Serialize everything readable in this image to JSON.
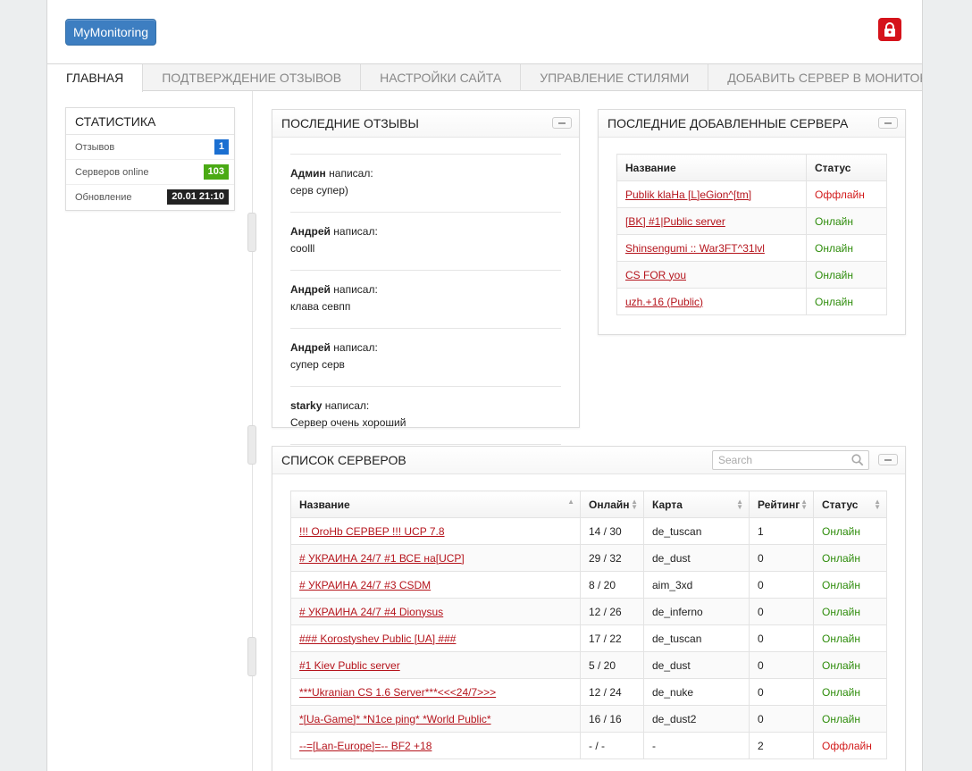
{
  "app": {
    "brand": "MyMonitoring"
  },
  "nav": {
    "items": [
      {
        "label": "ГЛАВНАЯ",
        "name": "nav-home"
      },
      {
        "label": "ПОДТВЕРЖДЕНИЕ ОТЗЫВОВ",
        "name": "nav-review-confirm"
      },
      {
        "label": "НАСТРОЙКИ САЙТА",
        "name": "nav-site-settings"
      },
      {
        "label": "УПРАВЛЕНИЕ СТИЛЯМИ",
        "name": "nav-style-manage"
      },
      {
        "label": "ДОБАВИТЬ СЕРВЕР В МОНИТОРИНГ",
        "name": "nav-add-server"
      }
    ],
    "active": 0
  },
  "stats": {
    "title": "СТАТИСТИКА",
    "rows": [
      {
        "label": "Отзывов",
        "value": "1",
        "color": "blue"
      },
      {
        "label": "Серверов online",
        "value": "103",
        "color": "green"
      },
      {
        "label": "Обновление",
        "value": "20.01 21:10",
        "color": "dark"
      }
    ]
  },
  "reviews": {
    "title": "ПОСЛЕДНИЕ ОТЗЫВЫ",
    "wrote": "написал:",
    "items": [
      {
        "author": "Админ",
        "text": "серв супер)"
      },
      {
        "author": "Андрей",
        "text": "coolll"
      },
      {
        "author": "Андрей",
        "text": "клава севпп"
      },
      {
        "author": "Андрей",
        "text": "супер серв"
      },
      {
        "author": "starky",
        "text": "Сервер очень хороший"
      }
    ]
  },
  "recent": {
    "title": "ПОСЛЕДНИЕ ДОБАВЛЕННЫЕ СЕРВЕРА",
    "headers": [
      "Название",
      "Статус"
    ],
    "rows": [
      {
        "name": "Publik klaHa [L]eGion^[tm]",
        "status": "Оффлайн",
        "online": false
      },
      {
        "name": "[BK] #1|Public server",
        "status": "Онлайн",
        "online": true
      },
      {
        "name": "Shinsengumi :: War3FT^31lvl",
        "status": "Онлайн",
        "online": true
      },
      {
        "name": "CS FOR you",
        "status": "Онлайн",
        "online": true
      },
      {
        "name": "uzh.+16 (Public)",
        "status": "Онлайн",
        "online": true
      }
    ]
  },
  "servers": {
    "title": "СПИСОК СЕРВЕРОВ",
    "search_placeholder": "Search",
    "headers": [
      "Название",
      "Онлайн",
      "Карта",
      "Рейтинг",
      "Статус"
    ],
    "rows": [
      {
        "name": "!!! OroHb СЕРВЕР !!! UCP 7.8",
        "online": "14 / 30",
        "map": "de_tuscan",
        "rating": "1",
        "status": "Онлайн",
        "up": true
      },
      {
        "name": "# УКРАИНА 24/7 #1 ВСЕ на[UCP]",
        "online": "29 / 32",
        "map": "de_dust",
        "rating": "0",
        "status": "Онлайн",
        "up": true
      },
      {
        "name": "# УКРАИНА 24/7 #3 CSDM",
        "online": "8 / 20",
        "map": "aim_3xd",
        "rating": "0",
        "status": "Онлайн",
        "up": true
      },
      {
        "name": "# УКРАИНА 24/7 #4 Dionysus",
        "online": "12 / 26",
        "map": "de_inferno",
        "rating": "0",
        "status": "Онлайн",
        "up": true
      },
      {
        "name": "### Korostyshev Public [UA] ###",
        "online": "17 / 22",
        "map": "de_tuscan",
        "rating": "0",
        "status": "Онлайн",
        "up": true
      },
      {
        "name": "#1 Kiev Public server",
        "online": "5 / 20",
        "map": "de_dust",
        "rating": "0",
        "status": "Онлайн",
        "up": true
      },
      {
        "name": "***Ukranian CS 1.6 Server***<<<24/7>>>",
        "online": "12 / 24",
        "map": "de_nuke",
        "rating": "0",
        "status": "Онлайн",
        "up": true
      },
      {
        "name": "*[Ua-Game]* *N1ce ping* *World Public*",
        "online": "16 / 16",
        "map": "de_dust2",
        "rating": "0",
        "status": "Онлайн",
        "up": true
      },
      {
        "name": "--=[Lan-Europe]=-- BF2 +18",
        "online": "- / -",
        "map": "-",
        "rating": "2",
        "status": "Оффлайн",
        "up": false
      }
    ]
  },
  "colors": {
    "brand": "#3d7ec1",
    "lock": "#d5131b",
    "link": "#b5141c",
    "online": "#2f8d0c",
    "offline": "#d21b1b"
  }
}
